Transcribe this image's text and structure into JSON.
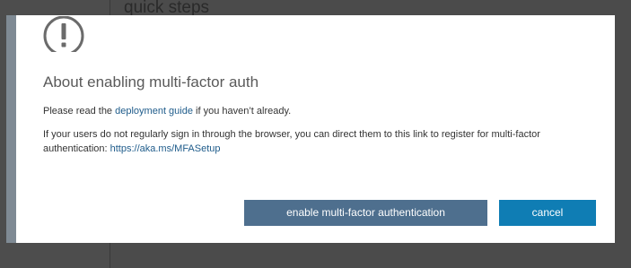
{
  "background": {
    "heading": "quick steps"
  },
  "dialog": {
    "icon": "exclamation-circle-icon",
    "title": "About enabling multi-factor auth",
    "para1": {
      "before": "Please read the ",
      "link": "deployment guide",
      "after": " if you haven’t already."
    },
    "para2": {
      "text": "If your users do not regularly sign in through the browser, you can direct them to this link to register for multi-factor authentication: ",
      "link": "https://aka.ms/MFASetup"
    },
    "buttons": {
      "enable": "enable multi-factor authentication",
      "cancel": "cancel"
    }
  },
  "colors": {
    "primary_button": "#4e6f8e",
    "cancel_button": "#0f7db4",
    "link": "#1f5c8b",
    "overlay": "#4a4a4a"
  }
}
